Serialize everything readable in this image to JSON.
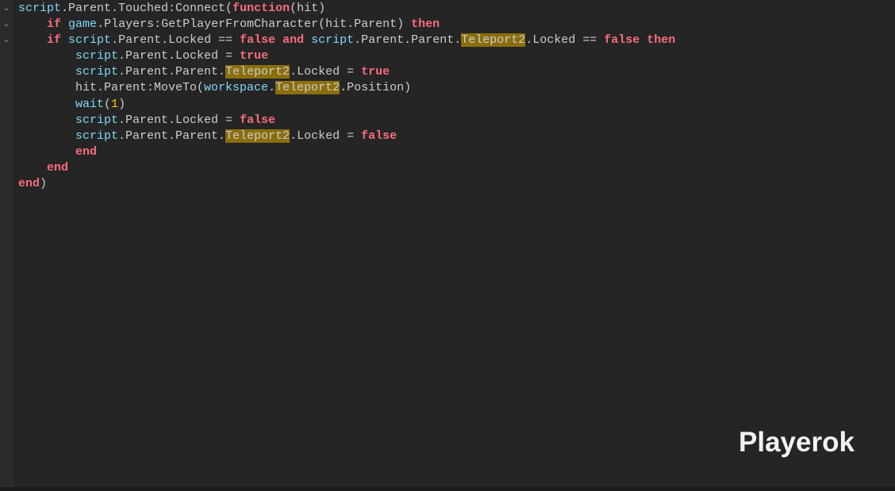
{
  "editor": {
    "fold_glyph": "⌄",
    "lines": [
      [
        {
          "t": "script",
          "c": "bi"
        },
        {
          "t": ".Parent.Touched:Connect(",
          "c": "op"
        },
        {
          "t": "function",
          "c": "kw"
        },
        {
          "t": "(hit)",
          "c": "op"
        }
      ],
      [
        {
          "t": "    ",
          "c": "op"
        },
        {
          "t": "if",
          "c": "kw"
        },
        {
          "t": " ",
          "c": "op"
        },
        {
          "t": "game",
          "c": "bi"
        },
        {
          "t": ".Players:GetPlayerFromCharacter(hit.Parent) ",
          "c": "op"
        },
        {
          "t": "then",
          "c": "kw"
        }
      ],
      [
        {
          "t": "    ",
          "c": "op"
        },
        {
          "t": "if",
          "c": "kw"
        },
        {
          "t": " ",
          "c": "op"
        },
        {
          "t": "script",
          "c": "bi"
        },
        {
          "t": ".Parent.Locked == ",
          "c": "op"
        },
        {
          "t": "false",
          "c": "kw"
        },
        {
          "t": " ",
          "c": "op"
        },
        {
          "t": "and",
          "c": "kw"
        },
        {
          "t": " ",
          "c": "op"
        },
        {
          "t": "script",
          "c": "bi"
        },
        {
          "t": ".Parent.Parent.",
          "c": "op"
        },
        {
          "t": "Teleport2",
          "c": "hl"
        },
        {
          "t": ".Locked == ",
          "c": "op"
        },
        {
          "t": "false",
          "c": "kw"
        },
        {
          "t": " ",
          "c": "op"
        },
        {
          "t": "then",
          "c": "kw"
        }
      ],
      [
        {
          "t": "        ",
          "c": "op"
        },
        {
          "t": "script",
          "c": "bi"
        },
        {
          "t": ".Parent.Locked = ",
          "c": "op"
        },
        {
          "t": "true",
          "c": "kw"
        }
      ],
      [
        {
          "t": "        ",
          "c": "op"
        },
        {
          "t": "script",
          "c": "bi"
        },
        {
          "t": ".Parent.Parent.",
          "c": "op"
        },
        {
          "t": "Teleport2",
          "c": "hl"
        },
        {
          "t": ".Locked = ",
          "c": "op"
        },
        {
          "t": "true",
          "c": "kw"
        }
      ],
      [
        {
          "t": "        hit.Parent:MoveTo(",
          "c": "op"
        },
        {
          "t": "workspace",
          "c": "bi"
        },
        {
          "t": ".",
          "c": "op"
        },
        {
          "t": "Teleport2",
          "c": "hl"
        },
        {
          "t": ".Position)",
          "c": "op"
        }
      ],
      [
        {
          "t": "        ",
          "c": "op"
        },
        {
          "t": "wait",
          "c": "bi"
        },
        {
          "t": "(",
          "c": "op"
        },
        {
          "t": "1",
          "c": "num"
        },
        {
          "t": ")",
          "c": "op"
        }
      ],
      [
        {
          "t": "        ",
          "c": "op"
        },
        {
          "t": "script",
          "c": "bi"
        },
        {
          "t": ".Parent.Locked = ",
          "c": "op"
        },
        {
          "t": "false",
          "c": "kw"
        }
      ],
      [
        {
          "t": "        ",
          "c": "op"
        },
        {
          "t": "script",
          "c": "bi"
        },
        {
          "t": ".Parent.Parent.",
          "c": "op"
        },
        {
          "t": "Teleport2",
          "c": "hl"
        },
        {
          "t": ".Locked = ",
          "c": "op"
        },
        {
          "t": "false",
          "c": "kw"
        }
      ],
      [
        {
          "t": "        ",
          "c": "op"
        },
        {
          "t": "end",
          "c": "kw"
        }
      ],
      [
        {
          "t": "    ",
          "c": "op"
        },
        {
          "t": "end",
          "c": "kw"
        }
      ],
      [
        {
          "t": "end",
          "c": "kw"
        },
        {
          "t": ")",
          "c": "op"
        }
      ]
    ]
  },
  "colors": {
    "background": "#252525",
    "keyword": "#f86d7c",
    "builtin": "#84d6f7",
    "number": "#ffc600",
    "highlight": "#8a6e0c"
  },
  "watermark": {
    "text": "Playerok"
  }
}
